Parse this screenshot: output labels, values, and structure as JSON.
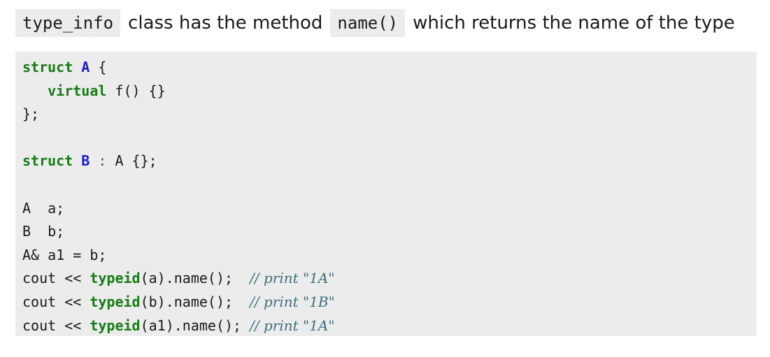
{
  "intro": {
    "term1": "type_info",
    "text1": "class has the method",
    "term2": "name()",
    "text2": "which returns the name of the type"
  },
  "code": {
    "line1": {
      "kw": "struct",
      "name": "A",
      "rest": " {"
    },
    "line2": {
      "indent": "   ",
      "kw": "virtual",
      "rest": " f() {}"
    },
    "line3": {
      "text": "};"
    },
    "line4": {
      "text": ""
    },
    "line5": {
      "kw": "struct",
      "name": "B",
      "colon": " : ",
      "rest": "A {};"
    },
    "line6": {
      "text": ""
    },
    "line7": {
      "text": "A  a;"
    },
    "line8": {
      "text": "B  b;"
    },
    "line9": {
      "text": "A& a1 = b;"
    },
    "line10": {
      "pre": "cout << ",
      "fn": "typeid",
      "mid": "(a).name();  ",
      "comment": "// print \"1A\""
    },
    "line11": {
      "pre": "cout << ",
      "fn": "typeid",
      "mid": "(b).name();  ",
      "comment": "// print \"1B\""
    },
    "line12": {
      "pre": "cout << ",
      "fn": "typeid",
      "mid": "(a1).name(); ",
      "comment": "// print \"1A\""
    }
  }
}
